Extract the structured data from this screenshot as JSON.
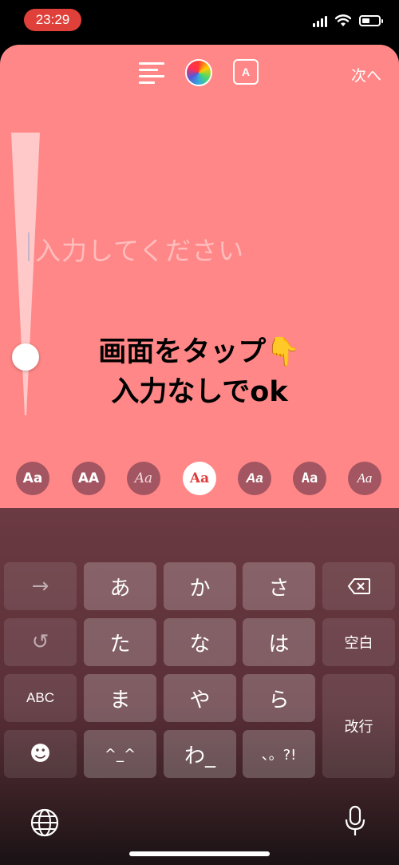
{
  "status_bar": {
    "time": "23:29",
    "battery_level": 0.45
  },
  "toolbar": {
    "align_icon": "text-align-left-icon",
    "color_icon": "color-wheel-icon",
    "effect_icon": "text-effect-icon",
    "effect_label": "A",
    "next_label": "次へ"
  },
  "editor": {
    "background_color": "#ff8787",
    "placeholder": "入力してください",
    "instruction_line1": "画面をタップ👇",
    "instruction_line2": "入力なしでok"
  },
  "font_styles": {
    "selected_index": 3,
    "chips": [
      "Aa",
      "AA",
      "Aa",
      "Aa",
      "Aa",
      "Aa",
      "Aa"
    ]
  },
  "keyboard": {
    "rows": [
      [
        "→",
        "あ",
        "か",
        "さ",
        "⌫"
      ],
      [
        "↺",
        "た",
        "な",
        "は",
        "空白"
      ],
      [
        "ABC",
        "ま",
        "や",
        "ら",
        "改行"
      ],
      [
        "☻",
        "^_^",
        "わ_",
        "、。?!"
      ]
    ],
    "globe_icon": "globe-icon",
    "mic_icon": "microphone-icon"
  }
}
